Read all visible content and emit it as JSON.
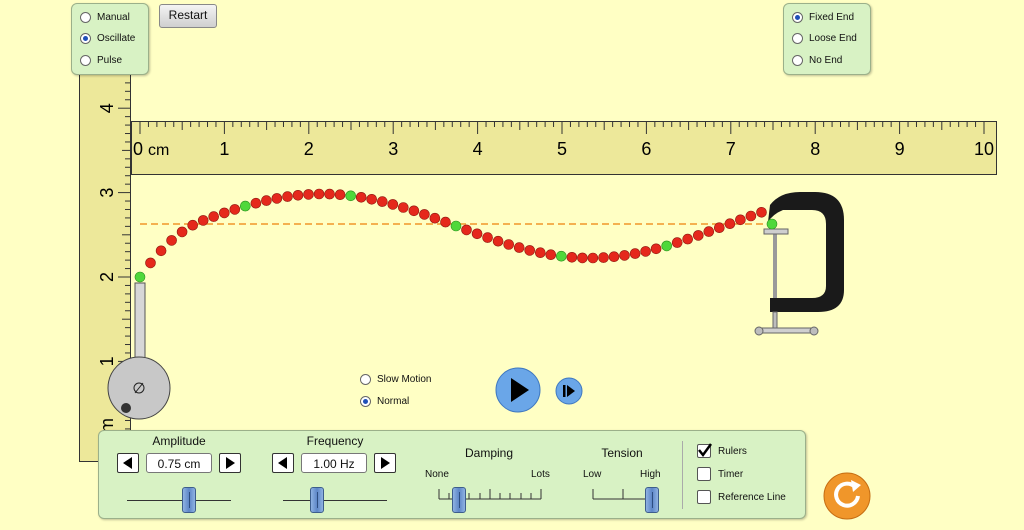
{
  "mode_panel": {
    "options": [
      "Manual",
      "Oscillate",
      "Pulse"
    ],
    "selected": "Oscillate"
  },
  "restart_label": "Restart",
  "end_panel": {
    "options": [
      "Fixed End",
      "Loose End",
      "No End"
    ],
    "selected": "Fixed End"
  },
  "horizontal_ruler": {
    "unit": "cm",
    "ticks": [
      "0",
      "1",
      "2",
      "3",
      "4",
      "5",
      "6",
      "7",
      "8",
      "9",
      "10"
    ]
  },
  "vertical_ruler": {
    "unit": "cm",
    "ticks": [
      "1",
      "2",
      "3",
      "4"
    ]
  },
  "speed": {
    "options": [
      "Slow Motion",
      "Normal"
    ],
    "selected": "Normal"
  },
  "controls": {
    "amplitude": {
      "label": "Amplitude",
      "value": "0.75 cm"
    },
    "frequency": {
      "label": "Frequency",
      "value": "1.00 Hz"
    },
    "damping": {
      "label": "Damping",
      "min_label": "None",
      "max_label": "Lots",
      "level": 0.0
    },
    "tension": {
      "label": "Tension",
      "min_label": "Low",
      "max_label": "High",
      "level": 1.0
    },
    "rulers": {
      "label": "Rulers",
      "checked": true
    },
    "timer": {
      "label": "Timer",
      "checked": false
    },
    "reference_line": {
      "label": "Reference Line",
      "checked": false
    }
  },
  "colors": {
    "background": "#ffffc4",
    "ruler": "#ede89a",
    "bead": "#e5281c",
    "green_bead": "#4fd83a",
    "panel": "#d8f2c4",
    "reset": "#f0962a",
    "play": "#6aa6e8"
  },
  "icons": [
    "play-icon",
    "step-icon",
    "reset-all-icon",
    "check-icon",
    "left-arrow-icon",
    "right-arrow-icon",
    "clamp-icon",
    "oscillator-icon"
  ]
}
